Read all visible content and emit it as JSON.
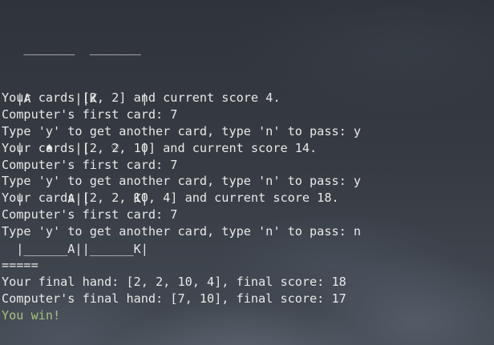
{
  "terminal": {
    "ascii_art": [
      "   _______  _______",
      "  |A      ||K      |",
      "  |   ♠   ||   ♡   |",
      "  |      A||      K|",
      "  |______A||______K|"
    ],
    "lines": [
      "Your cards [2, 2] and current score 4.",
      "Computer's first card: 7",
      "Type 'y' to get another card, type 'n' to pass: y",
      "Your cards [2, 2, 10] and current score 14.",
      "Computer's first card: 7",
      "Type 'y' to get another card, type 'n' to pass: y",
      "Your cards [2, 2, 10, 4] and current score 18.",
      "Computer's first card: 7",
      "Type 'y' to get another card, type 'n' to pass: n"
    ],
    "separator": "=====",
    "final_lines": [
      "Your final hand: [2, 2, 10, 4], final score: 18",
      "Computer's final hand: [7, 10], final score: 17"
    ],
    "result": "You win!",
    "result_color": "#a7c080"
  }
}
